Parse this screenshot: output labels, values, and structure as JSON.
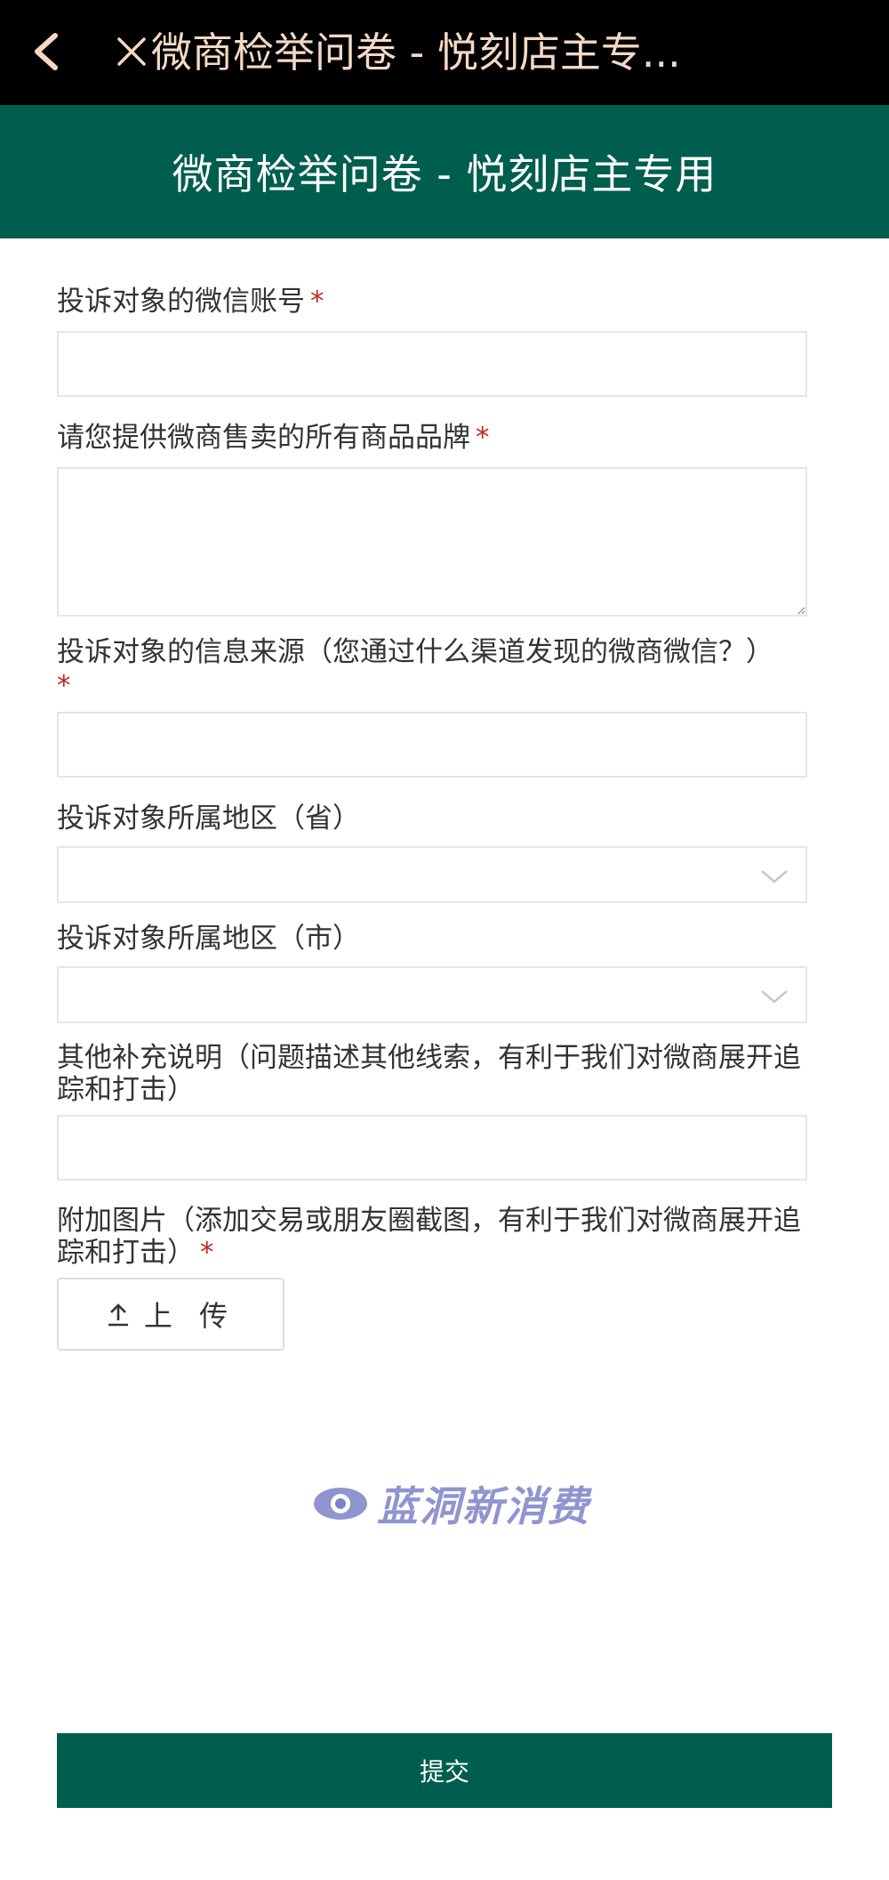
{
  "topbar": {
    "title": "微商检举问卷 - 悦刻店主专..."
  },
  "header": {
    "title": "微商检举问卷 - 悦刻店主专用"
  },
  "form": {
    "required_mark": "*",
    "fields": [
      {
        "label": "投诉对象的微信账号",
        "required": true,
        "value": ""
      },
      {
        "label": "请您提供微商售卖的所有商品品牌",
        "required": true,
        "value": ""
      },
      {
        "label": "投诉对象的信息来源（您通过什么渠道发现的微商微信？）",
        "required": true,
        "value": ""
      },
      {
        "label": "投诉对象所属地区（省）",
        "required": false,
        "value": ""
      },
      {
        "label": "投诉对象所属地区（市）",
        "required": false,
        "value": ""
      },
      {
        "label": "其他补充说明（问题描述其他线索，有利于我们对微商展开追踪和打击）",
        "required": false,
        "value": ""
      },
      {
        "label": "附加图片（添加交易或朋友圈截图，有利于我们对微商展开追踪和打击）",
        "required": true
      }
    ],
    "upload_label": "上 传",
    "submit_label": "提交"
  },
  "watermark": {
    "text": "蓝洞新消费"
  },
  "colors": {
    "header_bg": "#005e4e",
    "topbar_bg": "#000000",
    "topbar_text": "#f3d9c4",
    "required": "#c0281f",
    "watermark": "#7d82c8"
  },
  "icons": {
    "back": "chevron-left-icon",
    "close": "close-icon",
    "dropdown": "chevron-down-icon",
    "upload": "upload-icon"
  }
}
